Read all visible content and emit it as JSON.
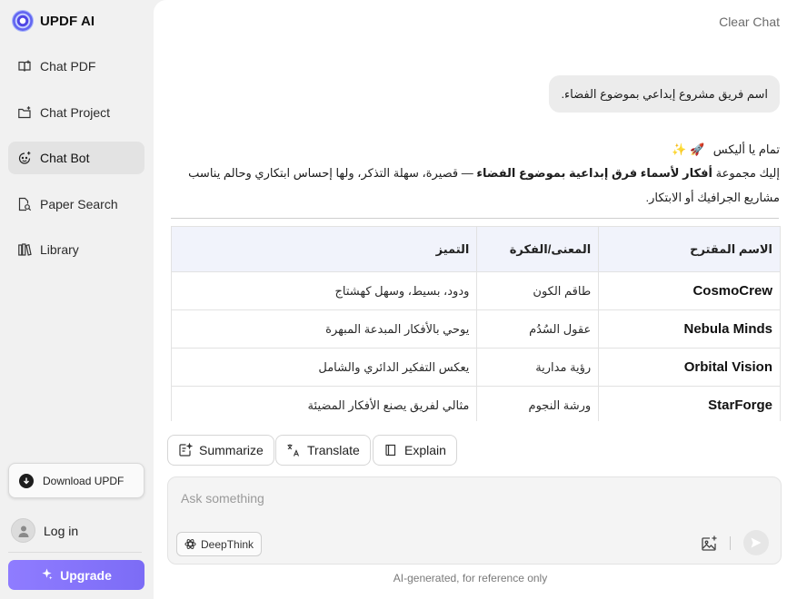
{
  "brand": {
    "name": "UPDF AI",
    "logo_icon": "updf-ai-logo-icon"
  },
  "sidebar": {
    "items": [
      {
        "label": "Chat PDF",
        "icon": "book-open-icon"
      },
      {
        "label": "Chat Project",
        "icon": "folder-plus-icon"
      },
      {
        "label": "Chat Bot",
        "icon": "bot-face-icon",
        "active": true
      },
      {
        "label": "Paper Search",
        "icon": "document-search-icon"
      },
      {
        "label": "Library",
        "icon": "library-books-icon"
      }
    ],
    "download_label": "Download UPDF",
    "login_label": "Log in",
    "upgrade_label": "Upgrade"
  },
  "header": {
    "clear_chat": "Clear Chat"
  },
  "chat": {
    "user_message": "اسم فريق مشروع إبداعي بموضوع الفضاء.",
    "answer_intro": "تمام يا أليكس",
    "answer_emoji": "🚀 ✨",
    "answer_para_prefix": "إليك مجموعة ",
    "answer_para_bold": "أفكار لأسماء فرق إبداعية بموضوع الفضاء",
    "answer_para_suffix": " — قصيرة، سهلة التذكر، ولها إحساس ابتكاري وحالم يناسب مشاريع الجرافيك أو الابتكار.",
    "table": {
      "headers": [
        "الاسم المقترح",
        "المعنى/الفكرة",
        "التميز"
      ],
      "rows": [
        [
          "CosmoCrew",
          "طاقم الكون",
          "ودود، بسيط، وسهل كهشتاج"
        ],
        [
          "Nebula Minds",
          "عقول السُدُم",
          "يوحي بالأفكار المبدعة المبهرة"
        ],
        [
          "Orbital Vision",
          "رؤية مدارية",
          "يعكس التفكير الدائري والشامل"
        ],
        [
          "StarForge",
          "ورشة النجوم",
          "مثالي لفريق يصنع الأفكار المضيئة"
        ]
      ]
    }
  },
  "quick_actions": {
    "summarize": "Summarize",
    "translate": "Translate",
    "explain": "Explain"
  },
  "composer": {
    "placeholder": "Ask something",
    "deepthink": "DeepThink"
  },
  "footer": {
    "disclaimer": "AI-generated, for reference only"
  },
  "colors": {
    "accent": "#8b7bff",
    "active_nav": "#e3e3e3",
    "table_header_bg": "#f1f3fb"
  }
}
